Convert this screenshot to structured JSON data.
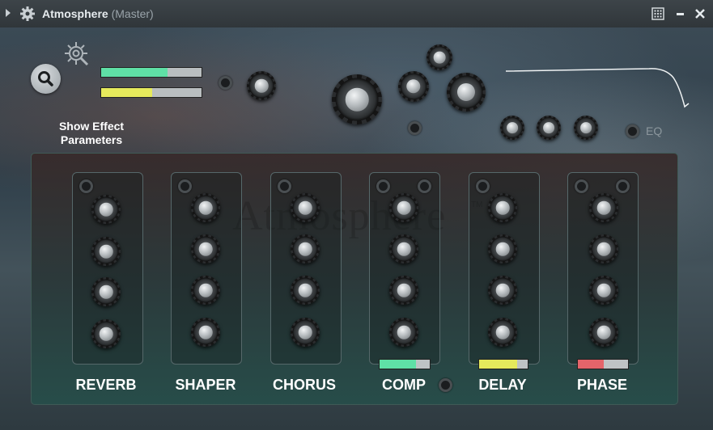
{
  "window": {
    "title": "Atmosphere",
    "subtitle": "(Master)"
  },
  "controls": {
    "show_effect_label": "Show Effect Parameters",
    "eq_label": "EQ",
    "meter_top_level": 0.66,
    "meter_bottom_level": 0.51
  },
  "watermark": {
    "text": "Atmosphere",
    "tm": "TM"
  },
  "colors": {
    "green": "#5fe0a6",
    "yellow": "#e6ea5c",
    "red": "#e4646a",
    "bar_bg": "#b9bec0"
  },
  "effects": [
    {
      "label": "REVERB",
      "bar_level": null,
      "bar_color": null
    },
    {
      "label": "SHAPER",
      "bar_level": null,
      "bar_color": null
    },
    {
      "label": "CHORUS",
      "bar_level": null,
      "bar_color": null
    },
    {
      "label": "COMP",
      "bar_level": 0.72,
      "bar_color": "#5fe0a6"
    },
    {
      "label": "DELAY",
      "bar_level": 0.78,
      "bar_color": "#e6ea5c"
    },
    {
      "label": "PHASE",
      "bar_level": 0.52,
      "bar_color": "#e4646a"
    }
  ]
}
